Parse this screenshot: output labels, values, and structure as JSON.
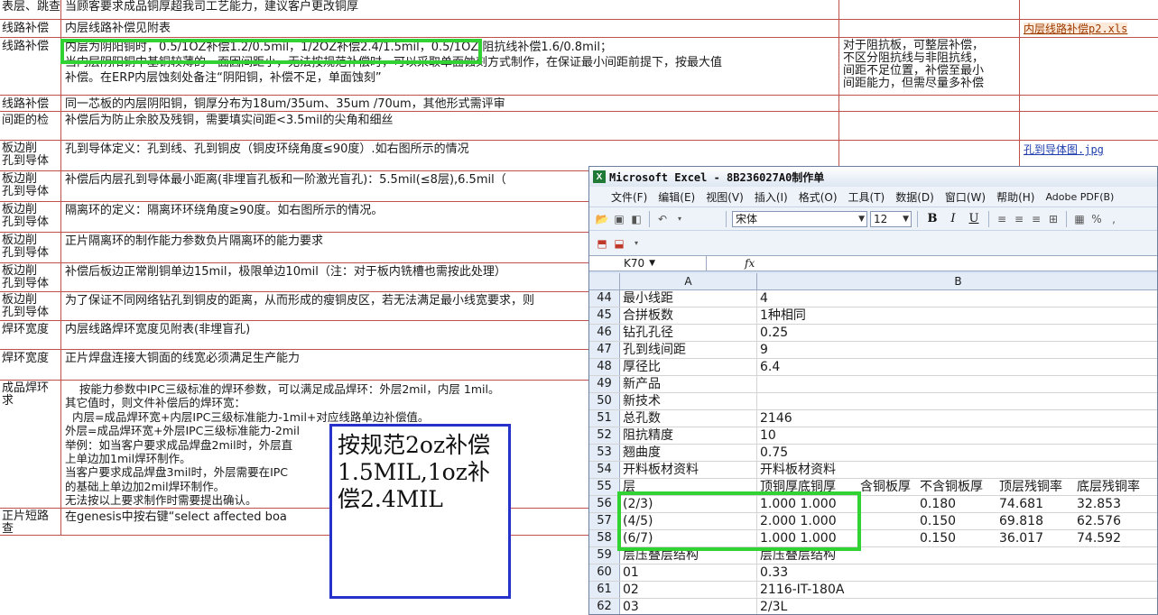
{
  "spec_sheet": {
    "rows": [
      {
        "category": "表层、跳查",
        "description": "当顾客要求成品铜厚超我司工艺能力，建议客户更改铜厚",
        "note": "",
        "link": ""
      },
      {
        "category": "线路补偿",
        "description": "内层线路补偿见附表",
        "note": "",
        "link": "内层线路补偿p2.xls"
      },
      {
        "category": "线路补偿",
        "description": "内层为阴阳铜时，0.5/1OZ补偿1.2/0.5mil，1/2OZ补偿2.4/1.5mil，0.5/1OZ 阻抗线补偿1.6/0.8mil；\n当内层阴阳铜中基铜较薄的一面因间距小，无法按规范补偿时，可以采取单面蚀刻方式制作，在保证最小间距前提下，按最大值\n补偿。在ERP内层蚀刻处备注“阴阳铜，补偿不足，单面蚀刻”",
        "note": "对于阻抗板，可整层补偿，\n不区分阻抗线与非阻抗线，\n间距不足位置，补偿至最小\n间距能力，但需尽量多补偿",
        "link": ""
      },
      {
        "category": "线路补偿",
        "description": "同一芯板的内层阴阳铜，铜厚分布为18um/35um、35um /70um，其他形式需评审",
        "note": "",
        "link": ""
      },
      {
        "category": "间距的检",
        "description": "补偿后为防止余胶及残铜，需要填实间距<3.5mil的尖角和细丝",
        "note": "",
        "link": ""
      },
      {
        "category": "板边削\n孔到导体",
        "description": "孔到导体定义：孔到线、孔到铜皮（铜皮环绕角度≤90度）.如右图所示的情况",
        "note": "",
        "link": "孔到导体图.jpg"
      },
      {
        "category": "板边削\n孔到导体",
        "description": "补偿后内层孔到导体最小距离(非埋盲孔板和一阶激光盲孔)：5.5mil(≤8层),6.5mil（",
        "note": "",
        "link": ""
      },
      {
        "category": "板边削\n孔到导体",
        "description": "隔离环的定义：隔离环环绕角度≥90度。如右图所示的情况。",
        "note": "",
        "link": ""
      },
      {
        "category": "板边削\n孔到导体",
        "description": "正片隔离环的制作能力参数负片隔离环的能力要求",
        "note": "",
        "link": ""
      },
      {
        "category": "板边削\n孔到导体",
        "description": "补偿后板边正常削铜单边15mil，极限单边10mil（注：对于板内铣槽也需按此处理）",
        "note": "",
        "link": ""
      },
      {
        "category": "板边削\n孔到导体",
        "description": "为了保证不同网络钻孔到铜皮的距离，从而形成的瘦铜皮区，若无法满足最小线宽要求，则",
        "note": "",
        "link": ""
      },
      {
        "category": "焊环宽度",
        "description": "内层线路焊环宽度见附表(非埋盲孔)",
        "note": "",
        "link": ""
      },
      {
        "category": "焊环宽度",
        "description": "正片焊盘连接大铜面的线宽必须满足生产能力",
        "note": "",
        "link": ""
      },
      {
        "category": "成品焊环\n求",
        "description": "    按能力参数中IPC三级标准的焊环参数，可以满足成品焊环：外层2mil，内层 1mil。\n其它值时，则文件补偿后的焊环宽：\n  内层=成品焊环宽+内层IPC三级标准能力-1mil+对应线路单边补偿值。\n外层=成品焊环宽+外层IPC三级标准能力-2mil                作即可，内层\n举例：如当客户要求成品焊盘2mil时，外层直\n上单边加1mil焊环制作。\n当客户要求成品焊盘3mil时，外层需要在IPC                     边加1mil焊环\n的基础上单边加2mil焊环制作。\n无法按以上要求制作时需要提出确认。",
        "note": "",
        "link": ""
      },
      {
        "category": "正片短路\n查",
        "description": "在genesis中按右键“select affected boa                     开短路。如果",
        "note": "",
        "link": ""
      }
    ]
  },
  "annotation": {
    "text": "按规范2oz补偿1.5MIL,1oz补偿2.4MIL"
  },
  "excel": {
    "title": "Microsoft Excel - 8B236027A0制作单",
    "menu": [
      "文件(F)",
      "编辑(E)",
      "视图(V)",
      "插入(I)",
      "格式(O)",
      "工具(T)",
      "数据(D)",
      "窗口(W)",
      "帮助(H)",
      "Adobe PDF(B)"
    ],
    "font_name": "宋体",
    "font_size": "12",
    "name_box": "K70",
    "fx": "fx",
    "col_headers": [
      "A",
      "B"
    ],
    "grid_rows": [
      {
        "n": "44",
        "a": "最小线距",
        "b": "4",
        "extra": []
      },
      {
        "n": "45",
        "a": "合拼板数",
        "b": "1种相同",
        "extra": []
      },
      {
        "n": "46",
        "a": "钻孔孔径",
        "b": "0.25",
        "extra": []
      },
      {
        "n": "47",
        "a": "孔到线间距",
        "b": "9",
        "extra": []
      },
      {
        "n": "48",
        "a": "厚径比",
        "b": "6.4",
        "extra": []
      },
      {
        "n": "49",
        "a": "新产品",
        "b": "",
        "extra": []
      },
      {
        "n": "50",
        "a": "新技术",
        "b": "",
        "extra": []
      },
      {
        "n": "51",
        "a": "总孔数",
        "b": "2146",
        "extra": []
      },
      {
        "n": "52",
        "a": "阻抗精度",
        "b": "10",
        "extra": []
      },
      {
        "n": "53",
        "a": "翘曲度",
        "b": "0.75",
        "extra": []
      },
      {
        "n": "54",
        "a": "开料板材资料",
        "b": "开料板材资料",
        "extra": []
      },
      {
        "n": "55",
        "a": "层",
        "b": "顶铜厚底铜厚",
        "extra": [
          "含铜板厚",
          "不含铜板厚",
          "顶层残铜率",
          "底层残铜率"
        ]
      },
      {
        "n": "56",
        "a": "(2/3)",
        "b": "1.000  1.000",
        "extra": [
          "",
          "0.180",
          "74.681",
          "32.853"
        ]
      },
      {
        "n": "57",
        "a": "(4/5)",
        "b": "2.000  1.000",
        "extra": [
          "",
          "0.150",
          "69.818",
          "62.576"
        ]
      },
      {
        "n": "58",
        "a": "(6/7)",
        "b": "1.000  1.000",
        "extra": [
          "",
          "0.150",
          "36.017",
          "74.592"
        ]
      },
      {
        "n": "59",
        "a": "层压叠层结构",
        "b": "层压叠层结构",
        "extra": []
      },
      {
        "n": "60",
        "a": "01",
        "b": "0.33",
        "extra": []
      },
      {
        "n": "61",
        "a": "02",
        "b": "2116-IT-180A",
        "extra": []
      },
      {
        "n": "62",
        "a": "03",
        "b": "2/3L",
        "extra": []
      }
    ]
  },
  "colors": {
    "grid_line": "#c0504d",
    "highlight": "#31d332",
    "annotation_border": "#2531c8"
  }
}
